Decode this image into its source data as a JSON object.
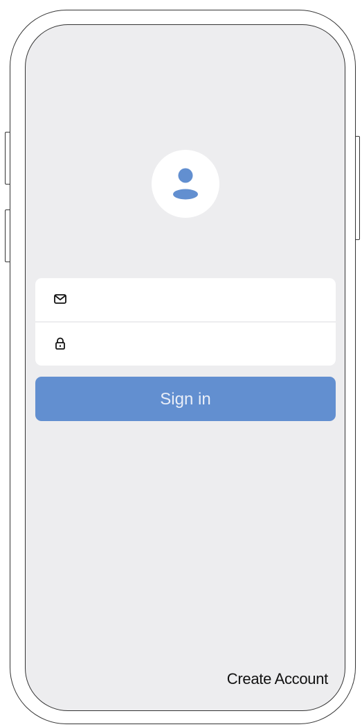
{
  "colors": {
    "screen_background": "#ededef",
    "accent": "#628fd0",
    "button_text": "#e9eef8",
    "field_background": "#ffffff",
    "device_outline": "#333333"
  },
  "avatar": {
    "icon": "person-icon"
  },
  "login_form": {
    "email_field": {
      "icon": "envelope-icon",
      "value": "",
      "placeholder": ""
    },
    "password_field": {
      "icon": "lock-icon",
      "value": "",
      "placeholder": ""
    },
    "sign_in_label": "Sign in"
  },
  "footer": {
    "create_account_label": "Create Account"
  }
}
